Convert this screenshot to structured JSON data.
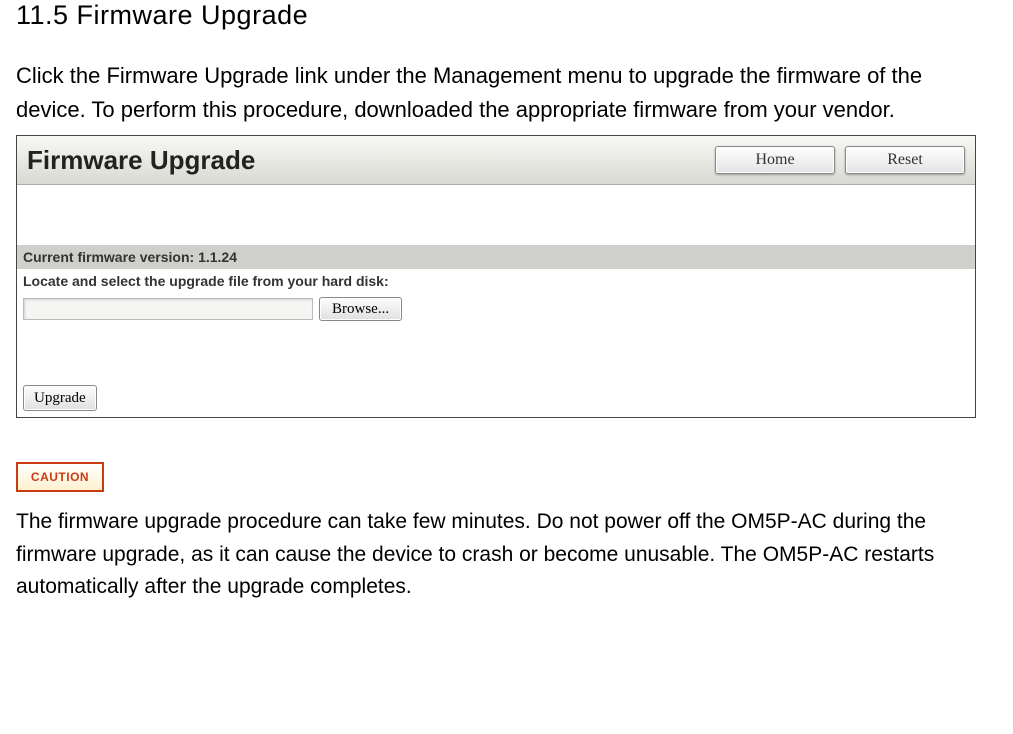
{
  "section": {
    "heading": "11.5 Firmware  Upgrade",
    "intro": "Click the Firmware Upgrade  link under the Management menu to upgrade the firmware of the device. To perform this procedure, downloaded the appropriate firmware from your vendor."
  },
  "panel": {
    "title": "Firmware Upgrade",
    "buttons": {
      "home": "Home",
      "reset": "Reset"
    },
    "firmware_label": "Current firmware version: ",
    "firmware_version": "1.1.24",
    "select_label": "Locate and select the upgrade file from your hard disk:",
    "file_value": "",
    "browse_label": "Browse...",
    "upgrade_label": "Upgrade"
  },
  "caution": {
    "badge": "CAUTION",
    "text": "The firmware  upgrade procedure  can take few minutes. Do not power off the OM5P-AC during the firmware upgrade, as it can cause the device to crash or become unusable.  The OM5P-AC restarts automatically after the upgrade completes."
  }
}
